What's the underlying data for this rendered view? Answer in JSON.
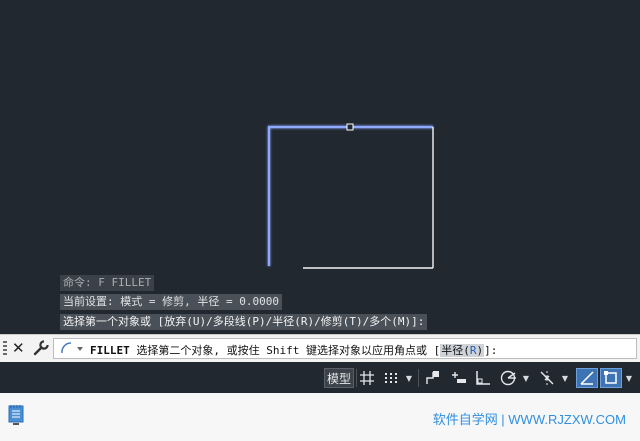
{
  "history": {
    "line1": "命令: F FILLET",
    "line2": "当前设置: 模式 = 修剪, 半径 = 0.0000",
    "line3": "选择第一个对象或 [放弃(U)/多段线(P)/半径(R)/修剪(T)/多个(M)]:"
  },
  "command": {
    "name": "FILLET",
    "prompt": " 选择第二个对象, 或按住 Shift 键选择对象以应用角点或 [",
    "option_prefix": "半径(",
    "option_key": "R",
    "option_suffix": ")",
    "tail": "]:"
  },
  "status": {
    "model_label": "模型"
  },
  "footer": {
    "watermark": "软件自学网 | WWW.RJZXW.COM"
  },
  "colors": {
    "canvas_bg": "#212830",
    "selected_line": "#8ea9ff",
    "line": "#ffffff",
    "accent": "#3f74b4"
  }
}
